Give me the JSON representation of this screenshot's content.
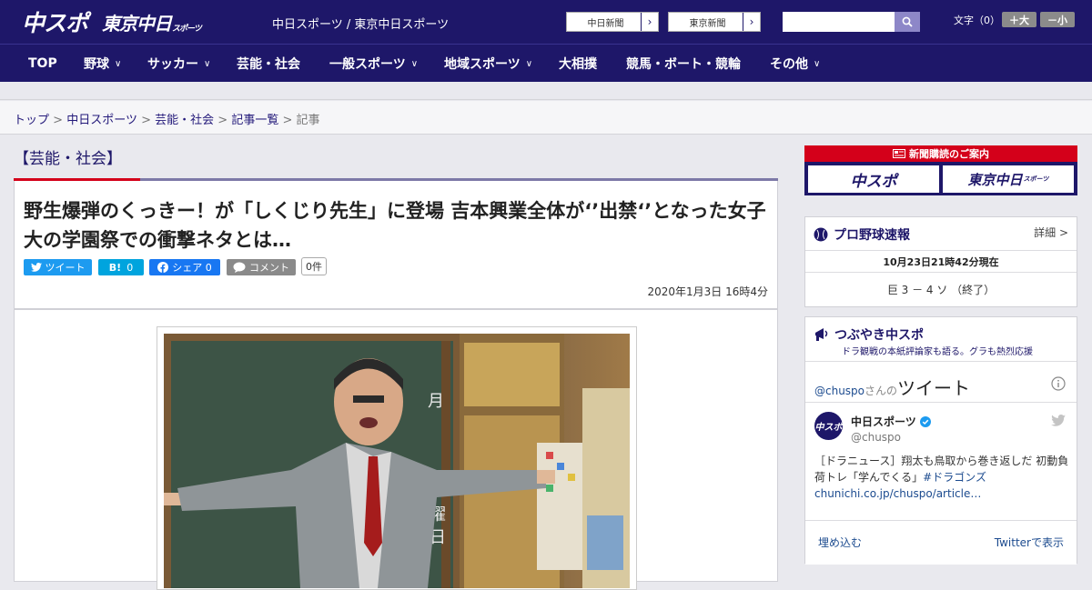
{
  "header": {
    "logo_chuspo": "中スポ",
    "logo_tokyo": "東京中日",
    "logo_tokyo_sub": "スポーツ",
    "site_names": "中日スポーツ / 東京中日スポーツ",
    "btn_chunichi": "中日新聞",
    "btn_tokyo": "東京新聞",
    "search_placeholder": "",
    "font_size_label": "文字（0）",
    "font_plus": "＋大",
    "font_minus": "－小"
  },
  "nav": {
    "items": [
      {
        "label": "TOP"
      },
      {
        "label": "野球"
      },
      {
        "label": "サッカー"
      },
      {
        "label": "芸能・社会"
      },
      {
        "label": "一般スポーツ"
      },
      {
        "label": "地域スポーツ"
      },
      {
        "label": "大相撲"
      },
      {
        "label": "競馬・ボート・競輪"
      },
      {
        "label": "その他"
      }
    ]
  },
  "breadcrumb": {
    "items": [
      "トップ",
      "中日スポーツ",
      "芸能・社会",
      "記事一覧"
    ],
    "current": "記事",
    "sep": ">"
  },
  "article": {
    "category": "【芸能・社会】",
    "headline": "野生爆弾のくっきー！が「しくじり先生」に登場 吉本興業全体が‘’出禁‘’となった女子大の学園祭での衝撃ネタとは…",
    "share": {
      "tweet": "ツイート",
      "hatena": "B!",
      "hatena_count": "0",
      "facebook": "シェア 0",
      "comment": "コメント",
      "comment_count": "0件"
    },
    "date": "2020年1月3日 16時4分"
  },
  "sidebar": {
    "subscribe_title": "新聞購読のご案内",
    "subscribe_logo1": "中スポ",
    "subscribe_logo2": "東京中日",
    "subscribe_logo2_sub": "スポーツ",
    "baseball": {
      "title": "プロ野球速報",
      "detail": "詳細 >",
      "updated": "10月23日21時42分現在",
      "score": "巨 3 － 4 ソ （終了）"
    },
    "tweets": {
      "title": "つぶやき中スポ",
      "subtitle": "ドラ観戦の本紙評論家も語る。グラも熱烈応援",
      "handle_prefix": "@chuspo",
      "handle_suffix": "さんの",
      "tweets_word": "ツイート",
      "account_name": "中日スポーツ",
      "account_handle": "@chuspo",
      "tweet_text": "［ドラニュース］翔太も鳥取から巻き返しだ 初動負荷トレ「学んでくる」",
      "tweet_hashtag": "#ドラゴンズ",
      "tweet_link": "chunichi.co.jp/chuspo/article…",
      "embed": "埋め込む",
      "view_on_twitter": "Twitterで表示"
    }
  },
  "colors": {
    "brand_navy": "#1e1769",
    "accent_red": "#d4001a",
    "twitter": "#1d9bf0",
    "hatena": "#00a4de",
    "facebook": "#1877f2"
  }
}
